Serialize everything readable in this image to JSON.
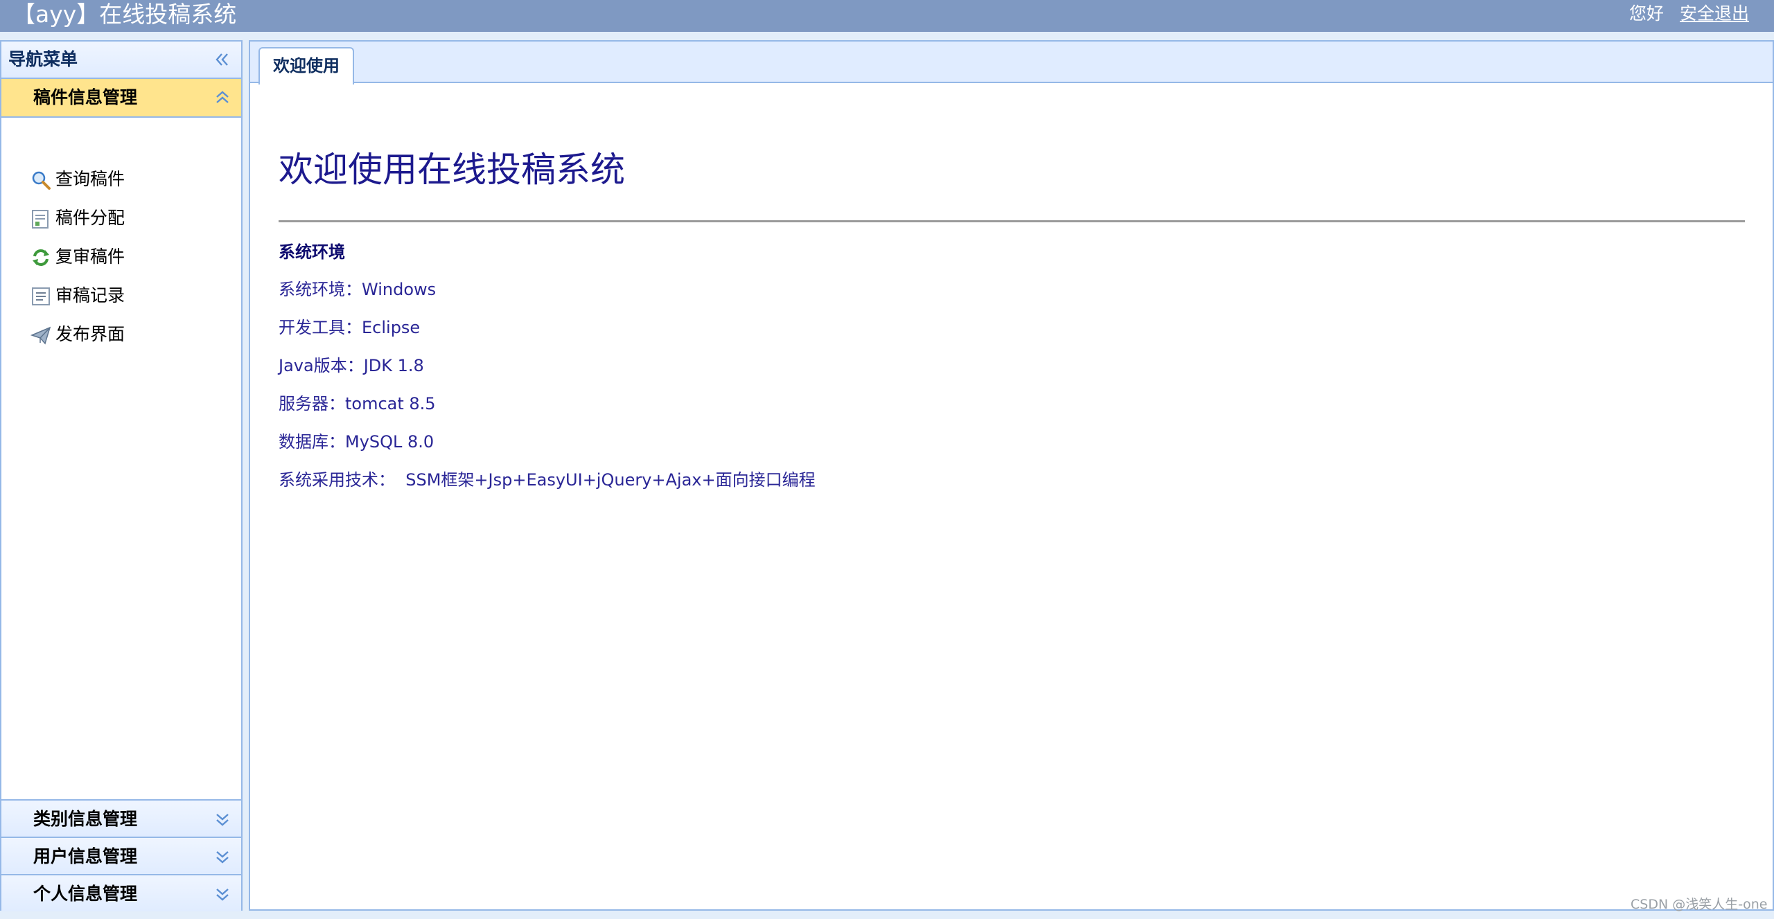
{
  "header": {
    "app_title": "【ayy】在线投稿系统",
    "greeting": "您好",
    "logout_label": "安全退出"
  },
  "sidebar": {
    "title": "导航菜单",
    "active_group": {
      "label": "稿件信息管理",
      "items": [
        {
          "label": "查询稿件",
          "icon": "search-icon"
        },
        {
          "label": "稿件分配",
          "icon": "assign-document-icon"
        },
        {
          "label": "复审稿件",
          "icon": "refresh-review-icon"
        },
        {
          "label": "审稿记录",
          "icon": "record-list-icon"
        },
        {
          "label": "发布界面",
          "icon": "send-paper-plane-icon"
        }
      ]
    },
    "collapsed_groups": [
      {
        "label": "类别信息管理"
      },
      {
        "label": "用户信息管理"
      },
      {
        "label": "个人信息管理"
      }
    ]
  },
  "main": {
    "tab_label": "欢迎使用",
    "welcome_title": "欢迎使用在线投稿系统",
    "section_heading": "系统环境",
    "info_lines": [
      "系统环境：Windows",
      "开发工具：Eclipse",
      "Java版本：JDK 1.8",
      "服务器：tomcat 8.5",
      "数据库：MySQL 8.0",
      "系统采用技术：  SSM框架+Jsp+EasyUI+jQuery+Ajax+面向接口编程"
    ]
  },
  "watermark": "CSDN @浅笑人生-one",
  "colors": {
    "header_bg": "#7F99C2",
    "panel_border": "#95B8E7",
    "active_group_bg": "#FFE48D",
    "title_text": "#1D1A8E",
    "info_text": "#2A2696"
  }
}
